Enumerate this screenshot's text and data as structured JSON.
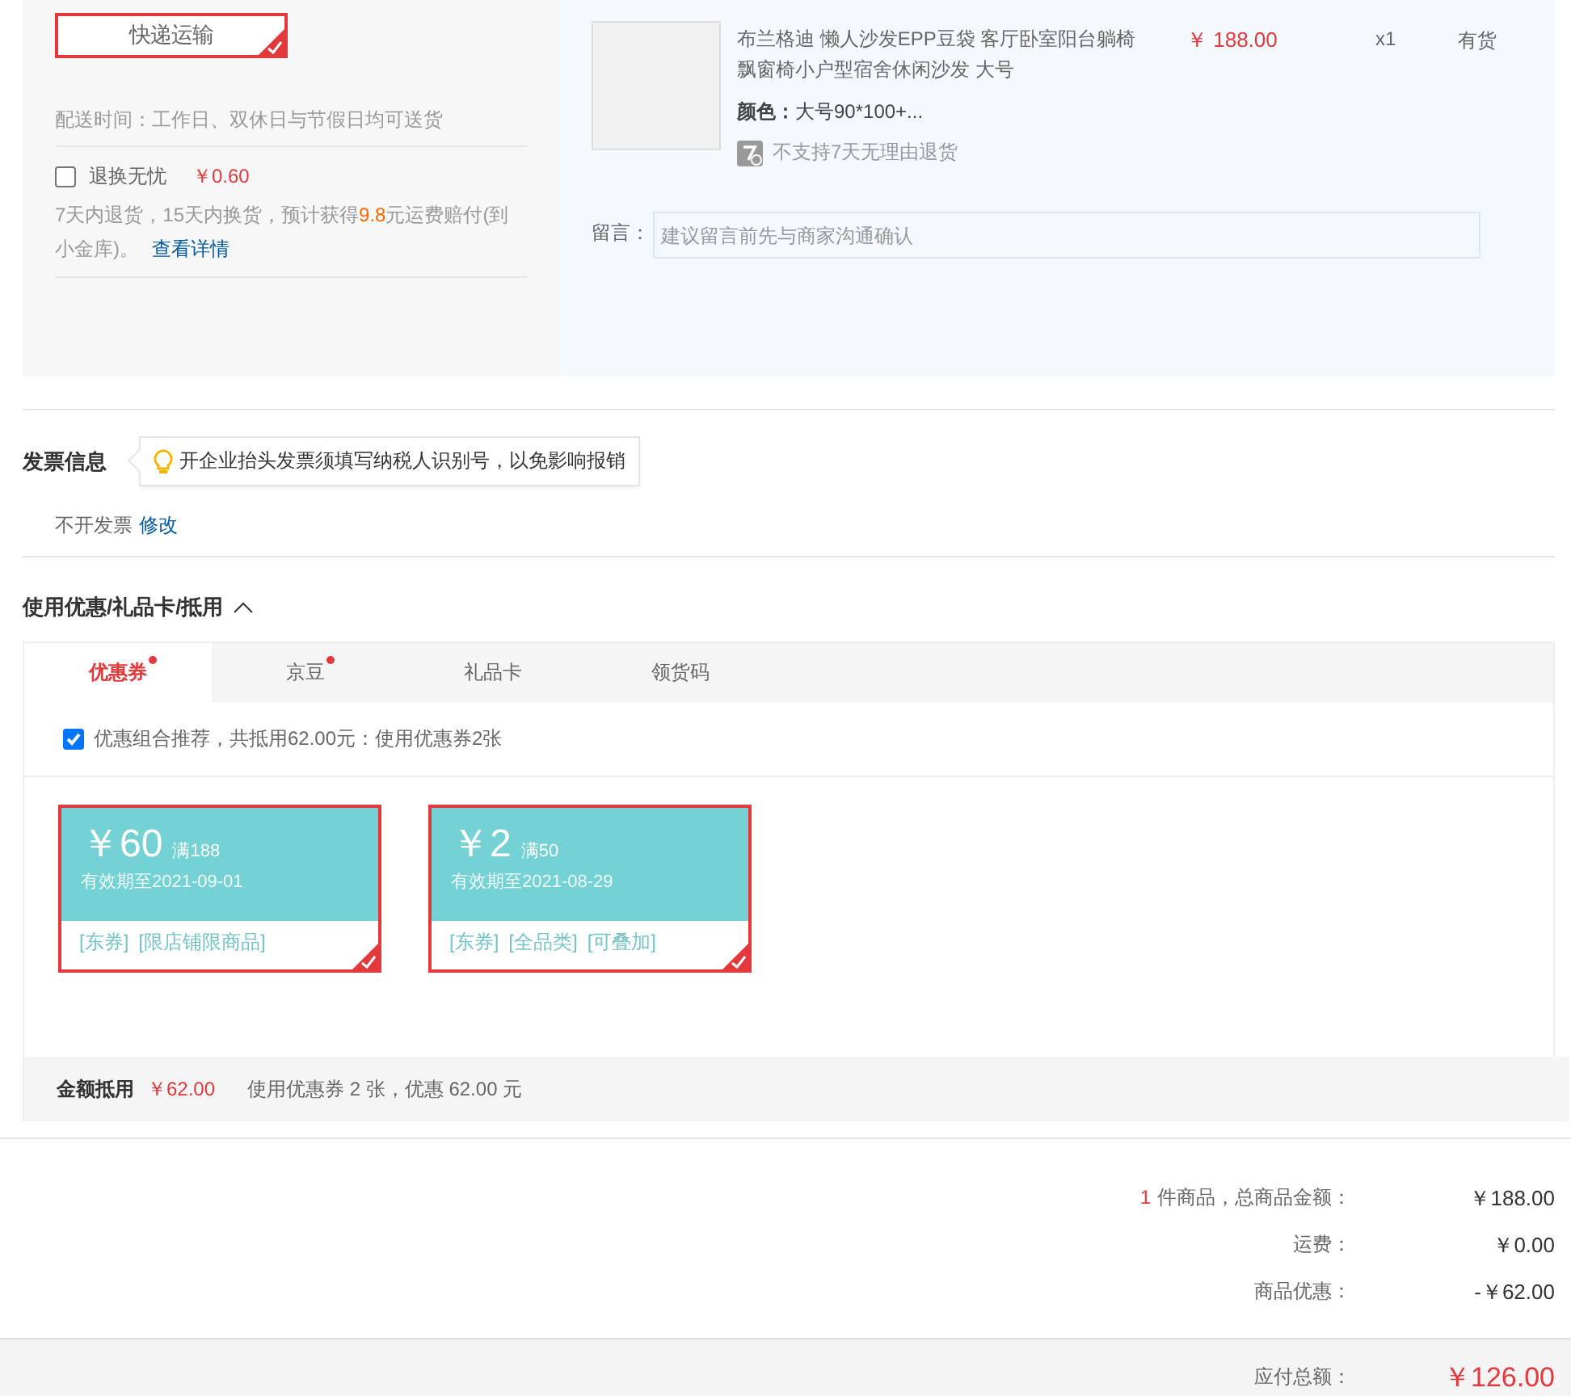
{
  "shipping": {
    "method": {
      "label": "快递运输",
      "selected": true
    },
    "delivery_time": "配送时间：工作日、双休日与节假日均可送货",
    "return_service": {
      "label": "退换无忧",
      "checked": false,
      "price": "￥0.60",
      "description": [
        "7天内退货，15天内换货，预计获得",
        "9.8",
        "元运费赔付(到小金库)。"
      ],
      "link": "查看详情"
    }
  },
  "product": {
    "title": "布兰格迪 懒人沙发EPP豆袋 客厅卧室阳台躺椅飘窗椅小户型宿舍休闲沙发 大号",
    "price": "￥ 188.00",
    "quantity": "x1",
    "stock": "有货",
    "color_label": "颜色：",
    "color_value": "大号90*100+...",
    "return_policy": "不支持7天无理由退货",
    "note_label": "留言：",
    "note_placeholder": "建议留言前先与商家沟通确认"
  },
  "invoice": {
    "title": "发票信息",
    "tip": "开企业抬头发票须填写纳税人识别号，以免影响报销",
    "status": "不开发票",
    "edit_link": "修改"
  },
  "discounts": {
    "title": "使用优惠/礼品卡/抵用",
    "expanded": true,
    "tabs": [
      {
        "label": "优惠券",
        "selected": true,
        "dot": true
      },
      {
        "label": "京豆",
        "selected": false,
        "dot": true
      },
      {
        "label": "礼品卡",
        "selected": false,
        "dot": false
      },
      {
        "label": "领货码",
        "selected": false,
        "dot": false
      }
    ],
    "recommend": {
      "label": "优惠组合推荐，共抵用62.00元：使用优惠券2张",
      "checked": true
    },
    "coupons": [
      {
        "amount": "￥60",
        "threshold": "满188",
        "expiry": "有效期至2021-09-01",
        "tags": [
          "[东券]",
          "[限店铺限商品]"
        ],
        "selected": true
      },
      {
        "amount": "￥2",
        "threshold": "满50",
        "expiry": "有效期至2021-08-29",
        "tags": [
          "[东券]",
          "[全品类]",
          "[可叠加]"
        ],
        "selected": true
      }
    ],
    "summary": {
      "label": "金额抵用",
      "amount": "￥62.00",
      "detail": "使用优惠券 2 张，优惠 62.00 元"
    }
  },
  "totals": {
    "rows": [
      {
        "count": "1",
        "label": "件商品，总商品金额：",
        "value": "￥188.00"
      },
      {
        "label": "运费：",
        "value": "￥0.00"
      },
      {
        "label": "商品优惠：",
        "value": "-￥62.00"
      }
    ],
    "payable": {
      "label": "应付总额：",
      "value": "￥126.00"
    }
  }
}
